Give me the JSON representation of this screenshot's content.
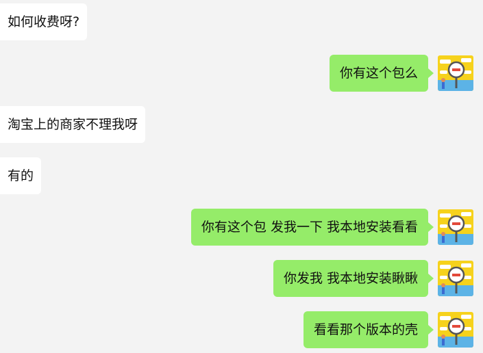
{
  "chat": {
    "messages": [
      {
        "side": "incoming",
        "text": "如何收费呀?"
      },
      {
        "side": "outgoing",
        "text": "你有这个包么"
      },
      {
        "side": "incoming",
        "text": "淘宝上的商家不理我呀"
      },
      {
        "side": "incoming",
        "text": "有的"
      },
      {
        "side": "outgoing",
        "text": "你有这个包 发我一下 我本地安装看看"
      },
      {
        "side": "outgoing",
        "text": "你发我 我本地安装瞅瞅"
      },
      {
        "side": "outgoing",
        "text": "看看那个版本的壳"
      }
    ]
  },
  "colors": {
    "background": "#f3f3f3",
    "incoming_bubble": "#ffffff",
    "outgoing_bubble": "#95ec69",
    "avatar_bg": "#f6d21c"
  },
  "icons": {
    "avatar": "avatar-magnifier-icon"
  }
}
